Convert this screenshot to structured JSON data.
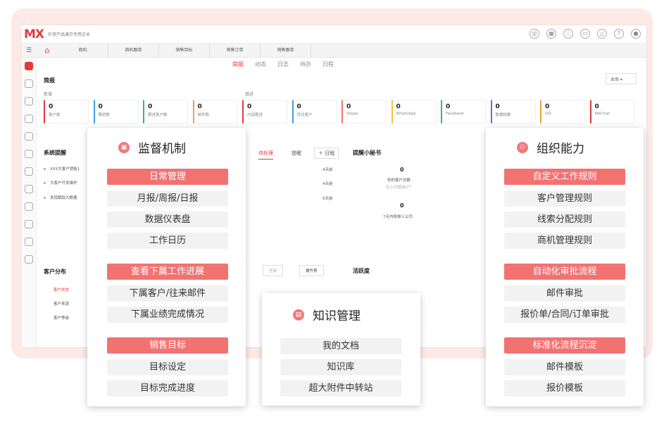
{
  "app": {
    "logo": "MX",
    "company": "外贸产品演示专用企业",
    "tabs": [
      "商机",
      "商机跟单",
      "销售目标",
      "销售订单",
      "销售跟单"
    ],
    "subnav": [
      "简报",
      "动态",
      "日志",
      "待办",
      "日程"
    ],
    "period": "本周",
    "brief_title": "简报",
    "new_label": "新增",
    "follow_label": "跟进",
    "kpis": [
      {
        "value": "0",
        "label": "客户数"
      },
      {
        "value": "0",
        "label": "跟进数"
      },
      {
        "value": "0",
        "label": "跟进客户数"
      },
      {
        "value": "0",
        "label": "邮件数"
      },
      {
        "value": "0",
        "label": "内部跟进"
      },
      {
        "value": "0",
        "label": "拜访客户"
      },
      {
        "value": "0",
        "label": "Skype"
      },
      {
        "value": "0",
        "label": "WhatsApp"
      },
      {
        "value": "0",
        "label": "Facebook"
      },
      {
        "value": "0",
        "label": "数据档案"
      },
      {
        "value": "0",
        "label": "QQ"
      },
      {
        "value": "0",
        "label": "WeChat"
      }
    ],
    "system_alert": {
      "title": "系统提醒",
      "items": [
        "XXX大客户销售1",
        "大客户开发维护",
        "发现跟踪大数据"
      ]
    },
    "todo": {
      "tab_pending": "待处理",
      "tab_remind": "提醒",
      "add_label": "＋ 日程",
      "times": [
        "4天前",
        "4天前",
        "6天前"
      ]
    },
    "secretary": {
      "title": "提醒小秘书",
      "v1": "0",
      "l1": "你的客户总数",
      "s1": "比上月增加0个",
      "v2": "0",
      "l2": "7天内将掉入公司"
    },
    "distribution": {
      "title": "客户分布",
      "items": [
        "客户状态",
        "客户来源",
        "客户等级"
      ]
    },
    "filter": {
      "all": "全部",
      "user": "谢竹青"
    },
    "activity": {
      "title": "活跃度"
    }
  },
  "cards": {
    "supervision": {
      "title": "监督机制",
      "sections": [
        {
          "header": "日常管理",
          "items": [
            "月报/周报/日报",
            "数据仪表盘",
            "工作日历"
          ]
        },
        {
          "header": "查看下属工作进展",
          "items": [
            "下属客户/往来邮件",
            "下属业绩完成情况"
          ]
        },
        {
          "header": "销售目标",
          "items": [
            "目标设定",
            "目标完成进度"
          ]
        }
      ]
    },
    "knowledge": {
      "title": "知识管理",
      "items": [
        "我的文档",
        "知识库",
        "超大附件中转站"
      ]
    },
    "organization": {
      "title": "组织能力",
      "sections": [
        {
          "header": "自定义工作规则",
          "items": [
            "客户管理规则",
            "线索分配规则",
            "商机管理规则"
          ]
        },
        {
          "header": "自动化审批流程",
          "items": [
            "邮件审批",
            "报价单/合同/订单审批"
          ]
        },
        {
          "header": "标准化流程沉淀",
          "items": [
            "邮件模板",
            "报价模板"
          ]
        }
      ]
    }
  }
}
